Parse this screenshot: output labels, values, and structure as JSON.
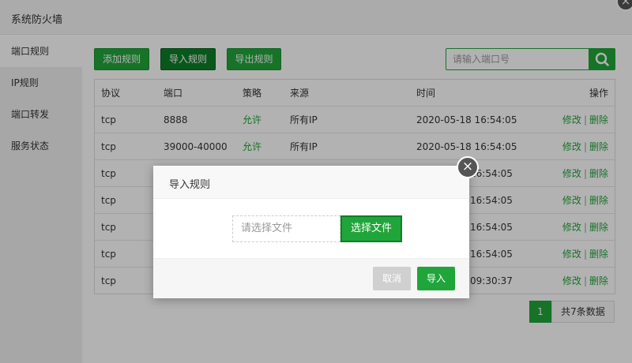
{
  "window": {
    "title": "系统防火墙"
  },
  "sidebar": {
    "items": [
      {
        "label": "端口规则",
        "active": true
      },
      {
        "label": "IP规则"
      },
      {
        "label": "端口转发"
      },
      {
        "label": "服务状态"
      }
    ]
  },
  "toolbar": {
    "add_label": "添加规则",
    "import_label": "导入规则",
    "export_label": "导出规则"
  },
  "search": {
    "placeholder": "请输入端口号"
  },
  "table": {
    "headers": {
      "protocol": "协议",
      "port": "端口",
      "policy": "策略",
      "source": "来源",
      "time": "时间",
      "ops": "操作"
    },
    "rows": [
      {
        "protocol": "tcp",
        "port": "8888",
        "policy": "允许",
        "source": "所有IP",
        "time": "2020-05-18 16:54:05"
      },
      {
        "protocol": "tcp",
        "port": "39000-40000",
        "policy": "允许",
        "source": "所有IP",
        "time": "2020-05-18 16:54:05"
      },
      {
        "protocol": "tcp",
        "port": "",
        "policy": "",
        "source": "",
        "time": "16:54:05"
      },
      {
        "protocol": "tcp",
        "port": "",
        "policy": "",
        "source": "",
        "time": "16:54:05"
      },
      {
        "protocol": "tcp",
        "port": "",
        "policy": "",
        "source": "",
        "time": "16:54:05"
      },
      {
        "protocol": "tcp",
        "port": "",
        "policy": "",
        "source": "",
        "time": "16:54:05"
      },
      {
        "protocol": "tcp",
        "port": "",
        "policy": "",
        "source": "",
        "time": "09:30:37"
      }
    ],
    "edit_label": "修改",
    "delete_label": "删除",
    "separator": "|"
  },
  "pager": {
    "current": "1",
    "total_text": "共7条数据"
  },
  "modal": {
    "title": "导入规则",
    "file_placeholder": "请选择文件",
    "choose_label": "选择文件",
    "cancel_label": "取消",
    "import_label": "导入",
    "close_glyph": "×"
  },
  "panel_close_glyph": "×",
  "colors": {
    "accent": "#20a53a",
    "accent_dark": "#0e7f27"
  }
}
